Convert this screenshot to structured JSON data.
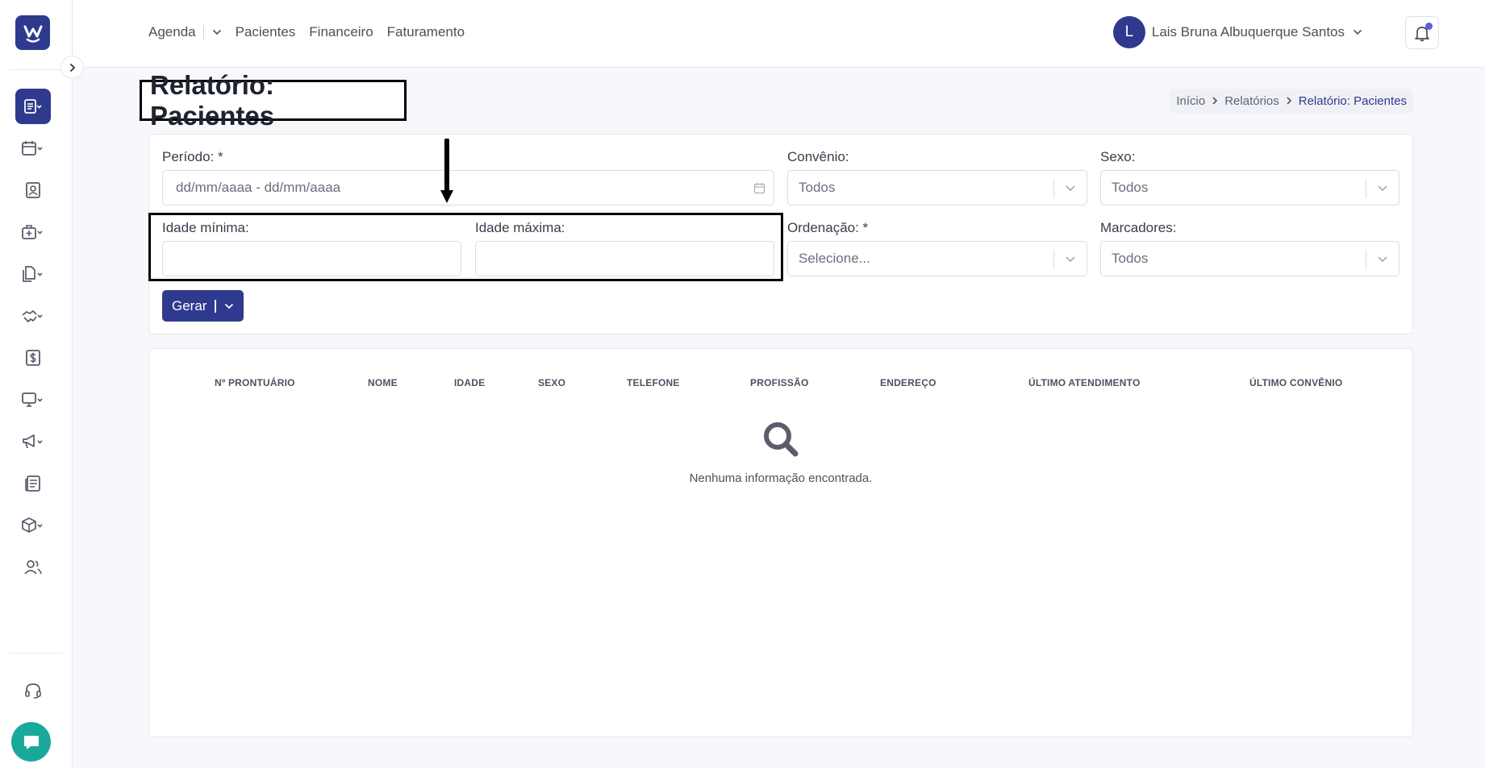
{
  "nav": {
    "items": [
      "Agenda",
      "Pacientes",
      "Financeiro",
      "Faturamento"
    ]
  },
  "user": {
    "initial": "L",
    "name": "Lais Bruna Albuquerque Santos"
  },
  "page": {
    "title": "Relatório: Pacientes"
  },
  "breadcrumb": [
    "Início",
    "Relatórios",
    "Relatório: Pacientes"
  ],
  "filters": {
    "periodo_label": "Período: *",
    "periodo_placeholder": "dd/mm/aaaa - dd/mm/aaaa",
    "convenio_label": "Convênio:",
    "convenio_value": "Todos",
    "sexo_label": "Sexo:",
    "sexo_value": "Todos",
    "idade_min_label": "Idade mínima:",
    "idade_min_value": "",
    "idade_max_label": "Idade máxima:",
    "idade_max_value": "",
    "ordenacao_label": "Ordenação: *",
    "ordenacao_value": "Selecione...",
    "marcadores_label": "Marcadores:",
    "marcadores_value": "Todos"
  },
  "actions": {
    "gerar_label": "Gerar"
  },
  "table": {
    "columns": [
      "Nº PRONTUÁRIO",
      "NOME",
      "IDADE",
      "SEXO",
      "TELEFONE",
      "PROFISSÃO",
      "ENDEREÇO",
      "ÚLTIMO ATENDIMENTO",
      "ÚLTIMO CONVÊNIO"
    ],
    "empty_message": "Nenhuma informação encontrada."
  },
  "colors": {
    "brand": "#2f3a8f",
    "chat": "#19a99a",
    "notification_dot": "#5b5fe0"
  },
  "icons": {
    "sidebar": [
      "reports-icon",
      "calendar-icon",
      "patient-card-icon",
      "medical-kit-icon",
      "documents-icon",
      "handshake-icon",
      "dollar-icon",
      "monitor-icon",
      "megaphone-icon",
      "newspaper-icon",
      "box-icon",
      "users-icon",
      "headset-icon"
    ]
  }
}
